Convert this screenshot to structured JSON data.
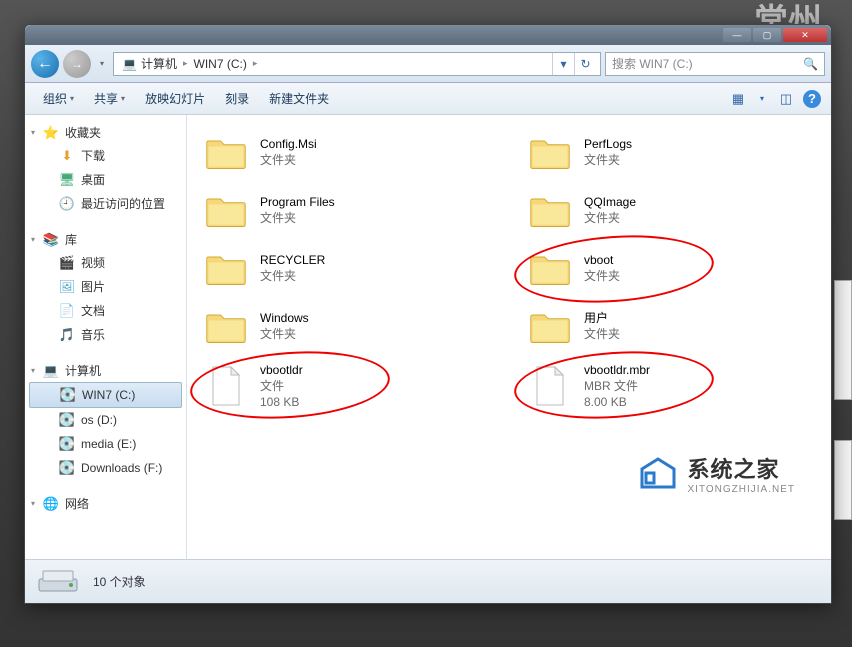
{
  "bg_text": "常州",
  "titlebar": {
    "min": "—",
    "max": "▢",
    "close": "✕"
  },
  "nav": {
    "back": "←",
    "fwd": "→",
    "dd": "▾",
    "breadcrumb": [
      {
        "icon": "💻",
        "label": "计算机"
      },
      {
        "icon": "",
        "label": "WIN7 (C:)"
      }
    ],
    "sep": "▸",
    "refresh": "↻"
  },
  "search": {
    "placeholder": "搜索 WIN7 (C:)",
    "icon": "🔍"
  },
  "toolbar": {
    "items": [
      {
        "label": "组织",
        "dd": true
      },
      {
        "label": "共享",
        "dd": true
      },
      {
        "label": "放映幻灯片",
        "dd": false
      },
      {
        "label": "刻录",
        "dd": false
      },
      {
        "label": "新建文件夹",
        "dd": false
      }
    ],
    "view_icon": "▦",
    "view_dd": "▾",
    "preview_icon": "◫",
    "help_icon": "?"
  },
  "sidebar": {
    "groups": [
      {
        "header": "收藏夹",
        "icon": "⭐",
        "items": [
          {
            "icon": "⬇",
            "label": "下载",
            "color": "#e8a030"
          },
          {
            "icon": "🖥",
            "label": "桌面",
            "color": "#4a7"
          },
          {
            "icon": "🕘",
            "label": "最近访问的位置",
            "color": "#7a5"
          }
        ]
      },
      {
        "header": "库",
        "icon": "📚",
        "items": [
          {
            "icon": "🎬",
            "label": "视频",
            "color": "#c55"
          },
          {
            "icon": "🖼",
            "label": "图片",
            "color": "#5ac"
          },
          {
            "icon": "📄",
            "label": "文档",
            "color": "#6a9"
          },
          {
            "icon": "🎵",
            "label": "音乐",
            "color": "#59c"
          }
        ]
      },
      {
        "header": "计算机",
        "icon": "💻",
        "items": [
          {
            "icon": "💽",
            "label": "WIN7 (C:)",
            "selected": true
          },
          {
            "icon": "💽",
            "label": "os (D:)"
          },
          {
            "icon": "💽",
            "label": "media (E:)"
          },
          {
            "icon": "💽",
            "label": "Downloads (F:)"
          }
        ]
      },
      {
        "header": "网络",
        "icon": "🌐",
        "items": []
      }
    ]
  },
  "files": [
    {
      "name": "Config.Msi",
      "type": "文件夹",
      "kind": "folder"
    },
    {
      "name": "PerfLogs",
      "type": "文件夹",
      "kind": "folder"
    },
    {
      "name": "Program Files",
      "type": "文件夹",
      "kind": "folder"
    },
    {
      "name": "QQImage",
      "type": "文件夹",
      "kind": "folder"
    },
    {
      "name": "RECYCLER",
      "type": "文件夹",
      "kind": "folder"
    },
    {
      "name": "vboot",
      "type": "文件夹",
      "kind": "folder",
      "circled": true
    },
    {
      "name": "Windows",
      "type": "文件夹",
      "kind": "folder"
    },
    {
      "name": "用户",
      "type": "文件夹",
      "kind": "folder"
    },
    {
      "name": "vbootldr",
      "type": "文件",
      "size": "108 KB",
      "kind": "file",
      "circled": true
    },
    {
      "name": "vbootldr.mbr",
      "type": "MBR 文件",
      "size": "8.00 KB",
      "kind": "file",
      "circled": true
    }
  ],
  "status": {
    "count_label": "10 个对象"
  },
  "watermark": {
    "title": "系统之家",
    "url": "XITONGZHIJIA.NET"
  }
}
